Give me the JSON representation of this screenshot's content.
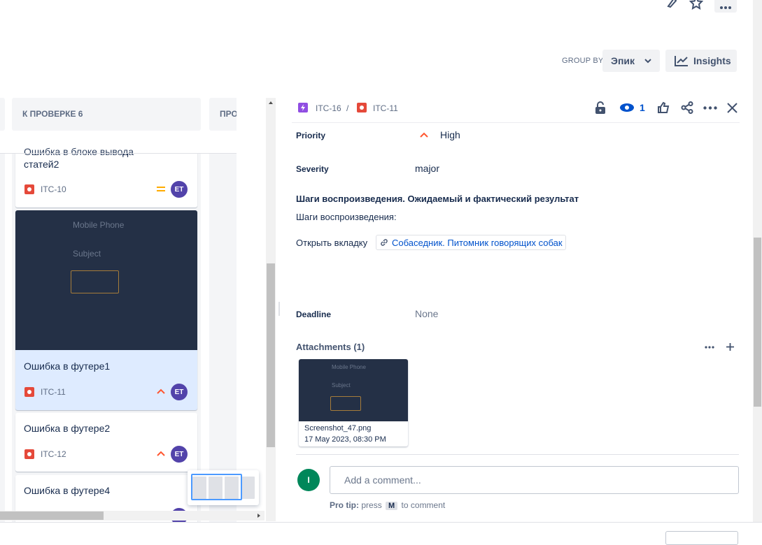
{
  "header": {
    "group_by_label": "GROUP BY",
    "group_by_value": "Эпик",
    "insights_label": "Insights"
  },
  "board": {
    "columns": [
      {
        "title": "К ПРОВЕРКЕ 6"
      },
      {
        "title": "ПРО"
      }
    ],
    "cards": [
      {
        "title_line1": "Ошибка в блоке вывода",
        "title_line2": "статей2",
        "key": "ITC-10",
        "priority": "medium",
        "assignee": "ET"
      },
      {
        "image_text1": "Mobile Phone",
        "image_text2": "Subject",
        "title": "Ошибка в футере1",
        "key": "ITC-11",
        "priority": "high",
        "assignee": "ET",
        "selected": true
      },
      {
        "title": "Ошибка в футере2",
        "key": "ITC-12",
        "priority": "high",
        "assignee": "ET"
      },
      {
        "title": "Ошибка в футере4"
      }
    ]
  },
  "detail": {
    "breadcrumb": {
      "parent": "ITC-16",
      "separator": "/",
      "current": "ITC-11"
    },
    "watchers": "1",
    "fields": {
      "priority_label": "Priority",
      "priority_value": "High",
      "severity_label": "Severity",
      "severity_value": "major",
      "steps_heading": "Шаги воспроизведения. Ожидаемый и фактический результат",
      "steps_line": "Шаги воспроизведения:",
      "open_tab_text": "Открыть вкладку",
      "link_text": "Собаседник. Питомник говорящих собак",
      "deadline_label": "Deadline",
      "deadline_value": "None"
    },
    "attachments": {
      "heading": "Attachments (1)",
      "file_name": "Screenshot_47.png",
      "file_date": "17 May 2023, 08:30 PM",
      "thumb_text1": "Mobile Phone",
      "thumb_text2": "Subject"
    },
    "comment": {
      "avatar": "I",
      "placeholder": "Add a comment...",
      "tip_bold": "Pro tip:",
      "tip_press": "press",
      "tip_key": "M",
      "tip_rest": "to comment"
    }
  },
  "colors": {
    "bug": "#e5493a",
    "epic": "#904ee2",
    "avatar": "#5243aa",
    "commenter": "#00875a",
    "link": "#0052cc",
    "priority_high": "#ff5630",
    "priority_medium": "#ffab00"
  }
}
